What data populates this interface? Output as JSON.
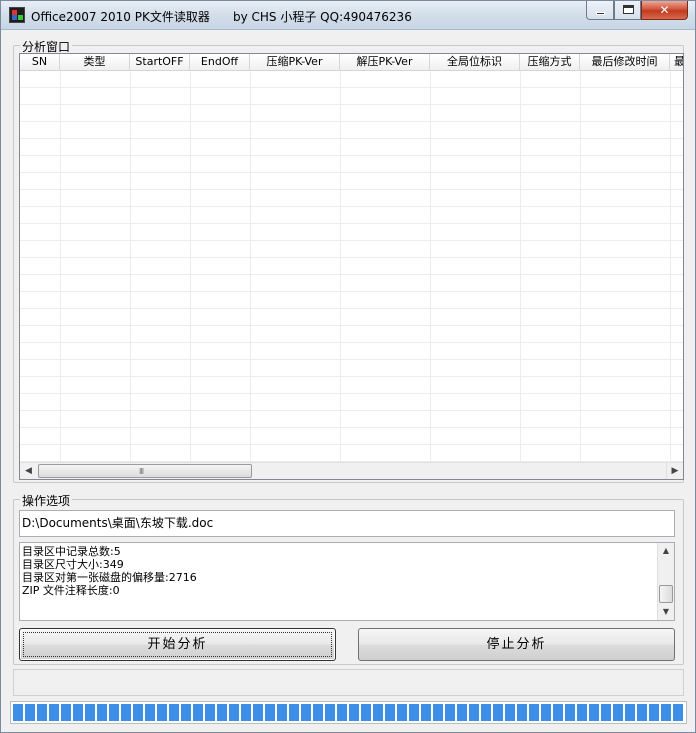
{
  "window": {
    "title": "Office2007 2010 PK文件读取器",
    "author": "by CHS 小程子 QQ:490476236",
    "controls": {
      "minimize": "minimize-icon",
      "maximize": "maximize-icon",
      "close": "close-icon"
    }
  },
  "analysis_group": {
    "label": "分析窗口",
    "columns": [
      "SN",
      "类型",
      "StartOFF",
      "EndOff",
      "压缩PK-Ver",
      "解压PK-Ver",
      "全局位标识",
      "压缩方式",
      "最后修改时间",
      "最"
    ],
    "rows": [],
    "hscroll_grip": "III"
  },
  "options_group": {
    "label": "操作选项",
    "file_path": "D:\\Documents\\桌面\\东坡下载.doc",
    "log_lines": [
      "目录区中记录总数:5",
      "目录区尺寸大小:349",
      "目录区对第一张磁盘的偏移量:2716",
      "ZIP 文件注释长度:0"
    ],
    "start_button": "开始分析",
    "stop_button": "停止分析"
  },
  "status": {
    "text": ""
  },
  "progress": {
    "value": 1.0
  },
  "colors": {
    "progress_fill": "#3c8ee6",
    "close_button": "#c23a1f"
  }
}
